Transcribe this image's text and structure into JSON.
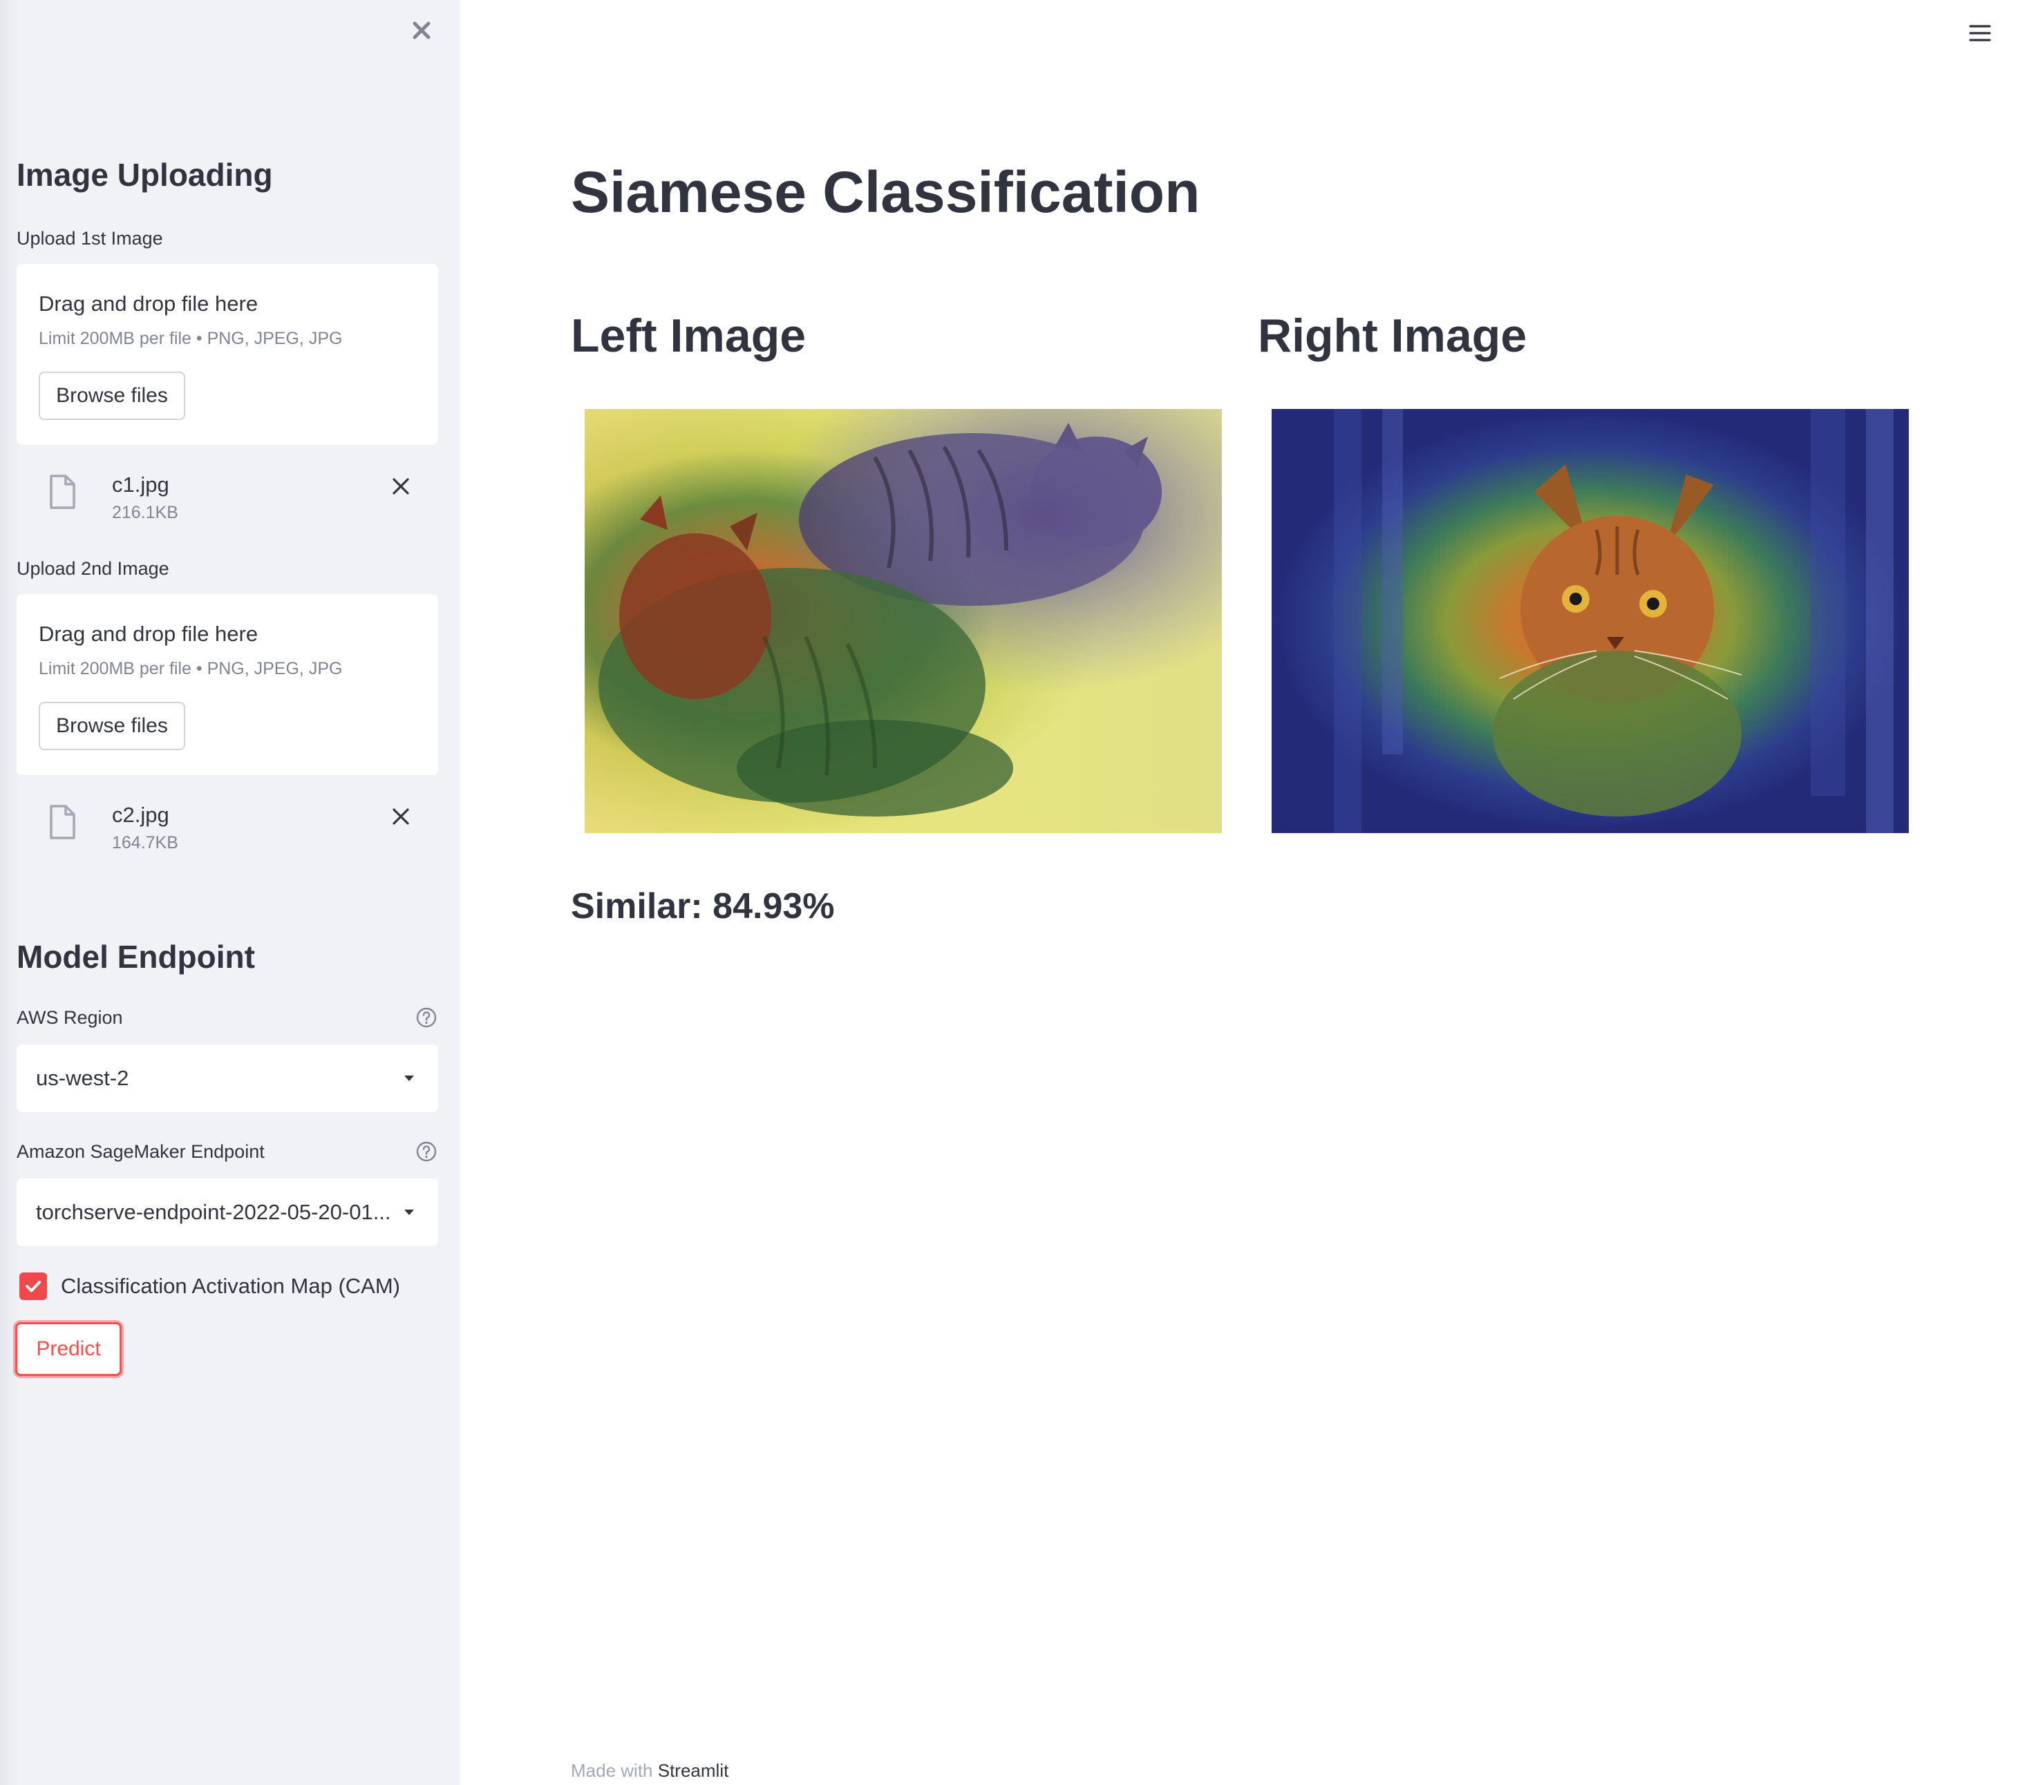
{
  "sidebar": {
    "uploading_heading": "Image Uploading",
    "upload1": {
      "label": "Upload 1st Image",
      "drop_title": "Drag and drop file here",
      "limit": "Limit 200MB per file • PNG, JPEG, JPG",
      "browse_label": "Browse files",
      "file_name": "c1.jpg",
      "file_size": "216.1KB"
    },
    "upload2": {
      "label": "Upload 2nd Image",
      "drop_title": "Drag and drop file here",
      "limit": "Limit 200MB per file • PNG, JPEG, JPG",
      "browse_label": "Browse files",
      "file_name": "c2.jpg",
      "file_size": "164.7KB"
    },
    "endpoint_heading": "Model Endpoint",
    "region": {
      "label": "AWS Region",
      "value": "us-west-2"
    },
    "endpoint": {
      "label": "Amazon SageMaker Endpoint",
      "value": "torchserve-endpoint-2022-05-20-01..."
    },
    "cam_checkbox": {
      "label": "Classification Activation Map (CAM)",
      "checked": true
    },
    "predict_label": "Predict"
  },
  "main": {
    "title": "Siamese Classification",
    "left_title": "Left Image",
    "right_title": "Right Image",
    "result": "Similar: 84.93%"
  },
  "footer": {
    "prefix": "Made with",
    "brand": "Streamlit"
  },
  "colors": {
    "accent": "#ff4b4b",
    "sidebar_bg": "#f0f2f6",
    "text": "#31333f",
    "muted": "#808495"
  },
  "icons": {
    "sidebar_close": "close-icon",
    "file": "file-icon",
    "remove": "close-icon",
    "help": "question-circle-icon",
    "dropdown": "caret-down-icon",
    "checkbox": "checkmark-icon",
    "menu": "hamburger-menu-icon"
  }
}
